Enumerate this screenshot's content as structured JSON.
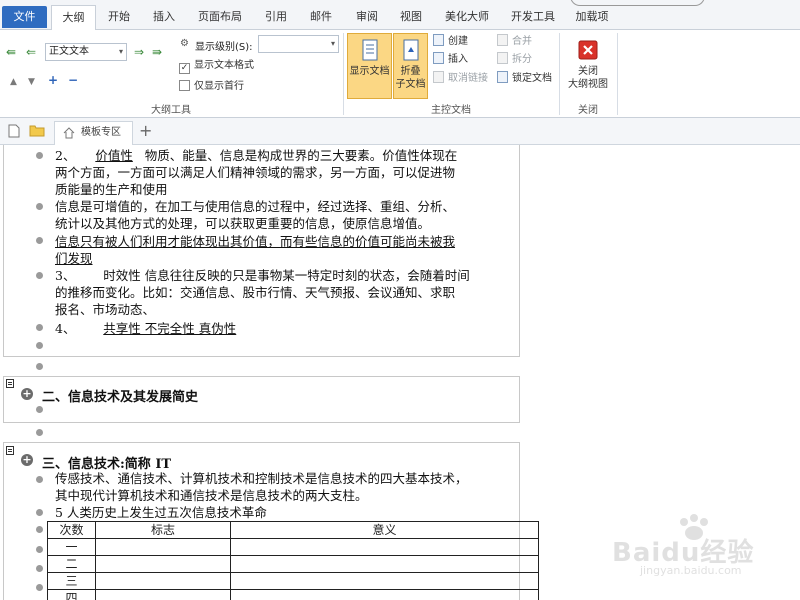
{
  "ribbon_tabs": {
    "file": "文件",
    "outline": "大纲",
    "home": "开始",
    "insert": "插入",
    "layout": "页面布局",
    "references": "引用",
    "mailings": "邮件",
    "review": "审阅",
    "view": "视图",
    "beautify": "美化大师",
    "developer": "开发工具",
    "addins": "加载项"
  },
  "outline_tools": {
    "level_select": "正文文本",
    "show_level_label": "显示级别(S):",
    "show_level_value": "",
    "show_text_format": "显示文本格式",
    "show_text_format_checked": true,
    "show_first_line": "仅显示首行",
    "show_first_line_checked": false,
    "group_label": "大纲工具"
  },
  "master_doc": {
    "show_document": "显示文档",
    "collapse_line1": "折叠",
    "collapse_line2": "子文档",
    "create": "创建",
    "insert": "插入",
    "unlink": "取消链接",
    "merge": "合并",
    "split": "拆分",
    "lock_document": "锁定文档",
    "group_label": "主控文档"
  },
  "close_group": {
    "close_line1": "关闭",
    "close_line2": "大纲视图",
    "group_label": "关闭"
  },
  "doc_tabs": {
    "template_zone": "模板专区"
  },
  "document": {
    "p2_num": "2、",
    "p2_term": "价值性",
    "p2_rest": "物质、能量、信息是构成世界的三大要素。价值性体现在",
    "p2_l2": "两个方面，一方面可以满足人们精神领域的需求，另一方面，可以促进物",
    "p2_l3": "质能量的生产和使用",
    "p_inc_l1": "信息是可增值的，在加工与使用信息的过程中，经过选择、重组、分析、",
    "p_inc_l2": "统计以及其他方式的处理，可以获取更重要的信息，使原信息增值。",
    "p_u_l1": "信息只有被人们利用才能体现出其价值，而有些信息的价值可能尚未被我",
    "p_u_l2": "们发现",
    "p3_num": "3、",
    "p3_rest": "时效性 信息往往反映的只是事物某一特定时刻的状态，会随着时间",
    "p3_l2": "的推移而变化。比如：交通信息、股市行情、天气预报、会议通知、求职",
    "p3_l3": "报名、市场动态、",
    "p4_num": "4、",
    "p4_rest": "共享性 不完全性 真伪性",
    "h2": "二、信息技术及其发展简史",
    "h3": "三、信息技术:简称 IT",
    "p_it_l1": "传感技术、通信技术、计算机技术和控制技术是信息技术的四大基本技术，",
    "p_it_l2": "其中现代计算机技术和通信技术是信息技术的两大支柱。",
    "p_rev": "5 人类历史上发生过五次信息技术革命",
    "table": {
      "headers": [
        "次数",
        "标志",
        "意义"
      ],
      "rows": [
        "一",
        "二",
        "三",
        "四"
      ]
    }
  },
  "watermark": {
    "brand": "Baidu经验",
    "url": "jingyan.baidu.com"
  },
  "colors": {
    "file_tab": "#2f6cc0",
    "active_button": "#fbd784",
    "close_icon": "#d9322a"
  }
}
